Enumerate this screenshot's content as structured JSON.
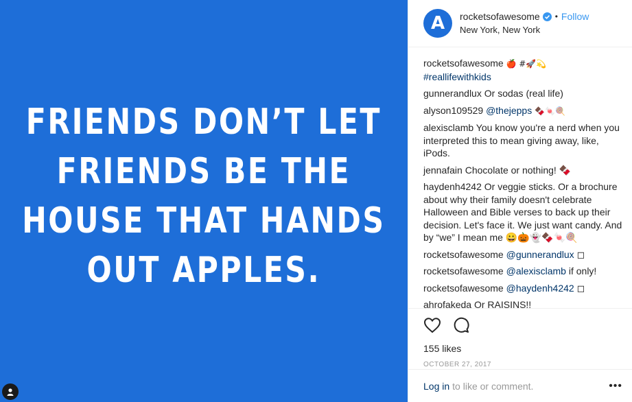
{
  "media": {
    "lines": [
      "FRIENDS DON’T LET",
      "FRIENDS BE THE",
      "HOUSE THAT HANDS",
      "OUT APPLES."
    ],
    "background": "#1e6ed8"
  },
  "header": {
    "avatar_letter": "A",
    "username": "rocketsofawesome",
    "separator": "•",
    "follow_label": "Follow",
    "location": "New York, New York"
  },
  "caption": {
    "username": "rocketsofawesome",
    "text": " 🍎 #🚀💫",
    "hashtag": "#reallifewithkids"
  },
  "comments": [
    {
      "user": "gunnerandlux",
      "text": "Or sodas (real life)",
      "mention": ""
    },
    {
      "user": "alyson109529",
      "mention": "@thejepps",
      "text": "🍫🍬🍭"
    },
    {
      "user": "alexisclamb",
      "mention": "",
      "text": "You know you're a nerd when you interpreted this to mean giving away, like, iPods."
    },
    {
      "user": "jennafain",
      "mention": "",
      "text": "Chocolate or nothing! 🍫"
    },
    {
      "user": "haydenh4242",
      "mention": "",
      "text": "Or veggie sticks. Or a brochure about why their family doesn't celebrate Halloween and Bible verses to back up their decision. Let's face it. We just want candy. And by “we” I mean me 😀🎃👻🍫🍬🍭"
    },
    {
      "user": "rocketsofawesome",
      "mention": "@gunnerandlux",
      "text": "◻"
    },
    {
      "user": "rocketsofawesome",
      "mention": "@alexisclamb",
      "text": "if only!"
    },
    {
      "user": "rocketsofawesome",
      "mention": "@haydenh4242",
      "text": "◻"
    },
    {
      "user": "ahrofakeda",
      "mention": "",
      "text": "Or RAISINS!!"
    }
  ],
  "actions": {
    "likes": "155 likes",
    "date": "OCTOBER 27, 2017"
  },
  "footer": {
    "login_label": "Log in",
    "login_rest": "to like or comment.",
    "more_label": "•••"
  },
  "colors": {
    "accent": "#3897f0",
    "link": "#003569",
    "muted": "#999999"
  }
}
